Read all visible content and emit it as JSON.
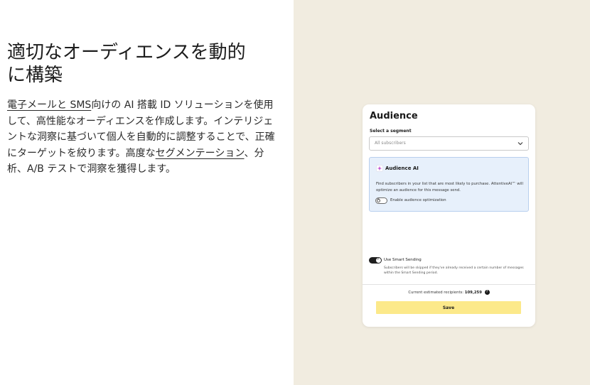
{
  "hero": {
    "headline_line1": "適切なオーディエンスを動的",
    "headline_line2": "に構築",
    "body": {
      "link1": "電子メールと SMS",
      "part1": "向けの AI 搭載 ID ソリューションを使用して、高性能なオーディエンスを作成します。インテリジェントな洞察に基づいて個人を自動的に調整することで、正確にターゲットを絞ります。高度な",
      "link2": "セグメンテーション",
      "part2": "、分析、A/B テストで洞察を獲得します。"
    }
  },
  "audience_card": {
    "title": "Audience",
    "segment_label": "Select a segment",
    "segment_value": "All subscribers",
    "ai": {
      "title": "Audience AI",
      "description": "Find subscribers in your list that are most likely to purchase. AttentiveAI™ will optimize an audience for this message send.",
      "toggle_label": "Enable audience optimization",
      "toggle_on": false
    },
    "smart_sending": {
      "label": "Use Smart Sending",
      "description": "Subscribers will be skipped if they've already received a certain number of messages within the Smart Sending period.",
      "toggle_on": true
    },
    "recipients_label": "Current estimated recipients:",
    "recipients_value": "109,259",
    "save_label": "Save"
  },
  "colors": {
    "right_background": "#f1ece0",
    "ai_box_background": "#e7f0fb",
    "save_button": "#fce98a"
  }
}
